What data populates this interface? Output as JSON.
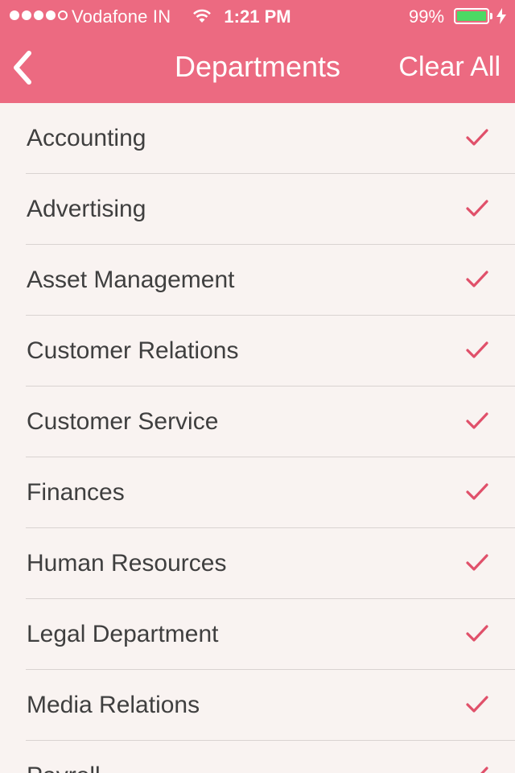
{
  "status_bar": {
    "carrier": "Vodafone IN",
    "time": "1:21 PM",
    "battery_percent": "99%",
    "battery_level": 0.99,
    "signal_bars_filled": 4,
    "signal_bars_total": 5
  },
  "nav": {
    "title": "Departments",
    "clear_all_label": "Clear All",
    "back_icon": "chevron-left-icon"
  },
  "colors": {
    "accent": "#ec6a81",
    "check": "#e0506a",
    "background": "#f9f3f1",
    "text": "#3f3f3f",
    "battery": "#4cd964"
  },
  "departments": [
    {
      "label": "Accounting",
      "checked": true
    },
    {
      "label": "Advertising",
      "checked": true
    },
    {
      "label": "Asset Management",
      "checked": true
    },
    {
      "label": "Customer Relations",
      "checked": true
    },
    {
      "label": "Customer Service",
      "checked": true
    },
    {
      "label": "Finances",
      "checked": true
    },
    {
      "label": "Human Resources",
      "checked": true
    },
    {
      "label": "Legal Department",
      "checked": true
    },
    {
      "label": "Media Relations",
      "checked": true
    },
    {
      "label": "Payroll",
      "checked": true
    }
  ]
}
